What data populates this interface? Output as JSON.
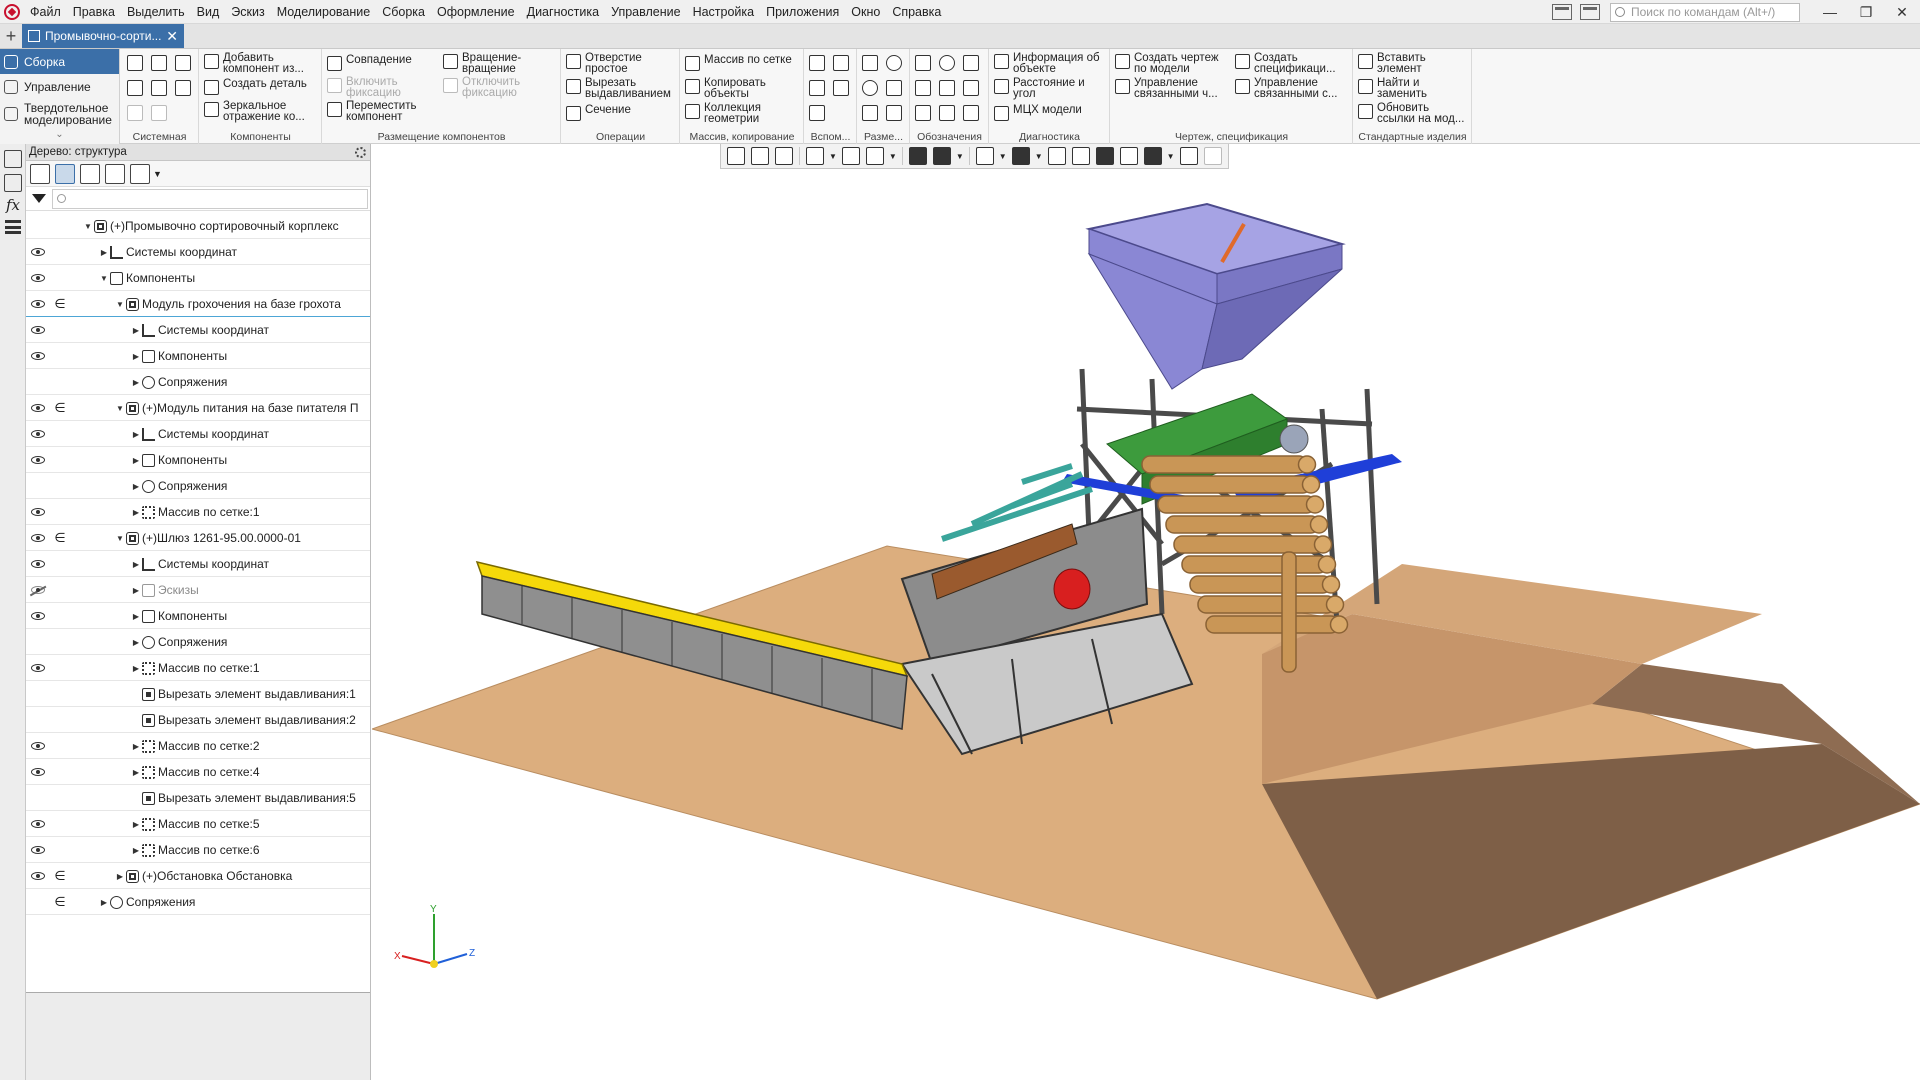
{
  "menu": [
    "Файл",
    "Правка",
    "Выделить",
    "Вид",
    "Эскиз",
    "Моделирование",
    "Сборка",
    "Оформление",
    "Диагностика",
    "Управление",
    "Настройка",
    "Приложения",
    "Окно",
    "Справка"
  ],
  "search_placeholder": "Поиск по командам (Alt+/)",
  "window_controls": {
    "minimize": "—",
    "restore": "❐",
    "close": "✕"
  },
  "document_tab": {
    "title": "Промывочно-сорти...",
    "close": "✕"
  },
  "ribbon_left": {
    "items": [
      "Сборка",
      "Управление",
      "Твердотельное моделирование"
    ],
    "active": "Сборка"
  },
  "ribbon": {
    "groups": {
      "system": "Системная",
      "components": "Компоненты",
      "placement": "Размещение компонентов",
      "operations": "Операции",
      "array": "Массив, копирование",
      "aux": "Вспом...",
      "dims": "Разме...",
      "marks": "Обозначения",
      "diag": "Диагностика",
      "drawing": "Чертеж, спецификация",
      "standard": "Стандартные изделия"
    },
    "buttons": {
      "add_component": "Добавить компонент из...",
      "create_part": "Создать деталь",
      "mirror": "Зеркальное отражение ко...",
      "coincidence": "Совпадение",
      "enable_fix": "Включить фиксацию",
      "move_component": "Переместить компонент",
      "rotation": "Вращение-вращение",
      "disable_fix": "Отключить фиксацию",
      "simple_hole": "Отверстие простое",
      "cut_extrude": "Вырезать выдавливанием",
      "section": "Сечение",
      "grid_array": "Массив по сетке",
      "copy_objects": "Копировать объекты",
      "geometry_collection": "Коллекция геометрии",
      "object_info": "Информация об объекте",
      "distance_angle": "Расстояние и угол",
      "mass_props": "МЦХ модели",
      "create_drawing": "Создать чертеж по модели",
      "manage_linked": "Управление связанными ч...",
      "create_spec": "Создать спецификаци...",
      "manage_linked_spec": "Управление связанными с...",
      "insert_element": "Вставить элемент",
      "find_replace": "Найти и заменить",
      "update_links": "Обновить ссылки на мод..."
    }
  },
  "tree": {
    "header": "Дерево: структура",
    "rows": [
      {
        "label": "(+)Промывочно сортировочный корплекс",
        "level": 0,
        "eye": "none",
        "in": false,
        "expanded": true,
        "icon": "asm"
      },
      {
        "label": "Системы координат",
        "level": 1,
        "eye": "on",
        "in": false,
        "expanded": false,
        "icon": "coord"
      },
      {
        "label": "Компоненты",
        "level": 1,
        "eye": "on",
        "in": false,
        "expanded": true,
        "icon": "comp"
      },
      {
        "label": "Модуль грохочения на базе грохота",
        "level": 2,
        "eye": "on",
        "in": true,
        "expanded": true,
        "icon": "asm",
        "selected": true
      },
      {
        "label": "Системы координат",
        "level": 3,
        "eye": "on",
        "in": false,
        "expanded": false,
        "icon": "coord"
      },
      {
        "label": "Компоненты",
        "level": 3,
        "eye": "on",
        "in": false,
        "expanded": false,
        "icon": "comp"
      },
      {
        "label": "Сопряжения",
        "level": 3,
        "eye": "none",
        "in": false,
        "expanded": false,
        "icon": "mate"
      },
      {
        "label": "(+)Модуль питания на базе питателя П",
        "level": 2,
        "eye": "on",
        "in": true,
        "expanded": true,
        "icon": "asm"
      },
      {
        "label": "Системы координат",
        "level": 3,
        "eye": "on",
        "in": false,
        "expanded": false,
        "icon": "coord"
      },
      {
        "label": "Компоненты",
        "level": 3,
        "eye": "on",
        "in": false,
        "expanded": false,
        "icon": "comp"
      },
      {
        "label": "Сопряжения",
        "level": 3,
        "eye": "none",
        "in": false,
        "expanded": false,
        "icon": "mate"
      },
      {
        "label": "Массив по сетке:1",
        "level": 3,
        "eye": "on",
        "in": false,
        "expanded": false,
        "icon": "array"
      },
      {
        "label": "(+)Шлюз 1261-95.00.0000-01",
        "level": 2,
        "eye": "on",
        "in": true,
        "expanded": true,
        "icon": "asm"
      },
      {
        "label": "Системы координат",
        "level": 3,
        "eye": "on",
        "in": false,
        "expanded": false,
        "icon": "coord"
      },
      {
        "label": "Эскизы",
        "level": 3,
        "eye": "hidden",
        "in": false,
        "expanded": false,
        "icon": "sketch",
        "dim": true
      },
      {
        "label": "Компоненты",
        "level": 3,
        "eye": "on",
        "in": false,
        "expanded": false,
        "icon": "comp"
      },
      {
        "label": "Сопряжения",
        "level": 3,
        "eye": "none",
        "in": false,
        "expanded": false,
        "icon": "mate"
      },
      {
        "label": "Массив по сетке:1",
        "level": 3,
        "eye": "on",
        "in": false,
        "expanded": false,
        "icon": "array"
      },
      {
        "label": "Вырезать элемент выдавливания:1",
        "level": 3,
        "eye": "none",
        "in": false,
        "expanded": null,
        "icon": "cut"
      },
      {
        "label": "Вырезать элемент выдавливания:2",
        "level": 3,
        "eye": "none",
        "in": false,
        "expanded": null,
        "icon": "cut"
      },
      {
        "label": "Массив по сетке:2",
        "level": 3,
        "eye": "on",
        "in": false,
        "expanded": false,
        "icon": "array"
      },
      {
        "label": "Массив по сетке:4",
        "level": 3,
        "eye": "on",
        "in": false,
        "expanded": false,
        "icon": "array"
      },
      {
        "label": "Вырезать элемент выдавливания:5",
        "level": 3,
        "eye": "none",
        "in": false,
        "expanded": null,
        "icon": "cut"
      },
      {
        "label": "Массив по сетке:5",
        "level": 3,
        "eye": "on",
        "in": false,
        "expanded": false,
        "icon": "array"
      },
      {
        "label": "Массив по сетке:6",
        "level": 3,
        "eye": "on",
        "in": false,
        "expanded": false,
        "icon": "array"
      },
      {
        "label": "(+)Обстановка Обстановка",
        "level": 2,
        "eye": "on",
        "in": true,
        "expanded": false,
        "icon": "asm"
      },
      {
        "label": "Сопряжения",
        "level": 1,
        "eye": "none",
        "in": true,
        "expanded": false,
        "icon": "mate"
      }
    ]
  },
  "axes": {
    "x": "X",
    "y": "Y",
    "z": "Z"
  },
  "colors": {
    "accent": "#3b6fa8",
    "ground": "#dcae7e",
    "berm_side": "#8b6a4f",
    "conveyor": "#f5d90a",
    "hopper": "#8a87d4",
    "screen_body": "#8c8c8c",
    "feeder": "#3d9b3d",
    "motor_red": "#d81f1f",
    "logs": "#c99656",
    "teal_pipes": "#3aa59b",
    "base_blue": "#1f3fd8"
  }
}
